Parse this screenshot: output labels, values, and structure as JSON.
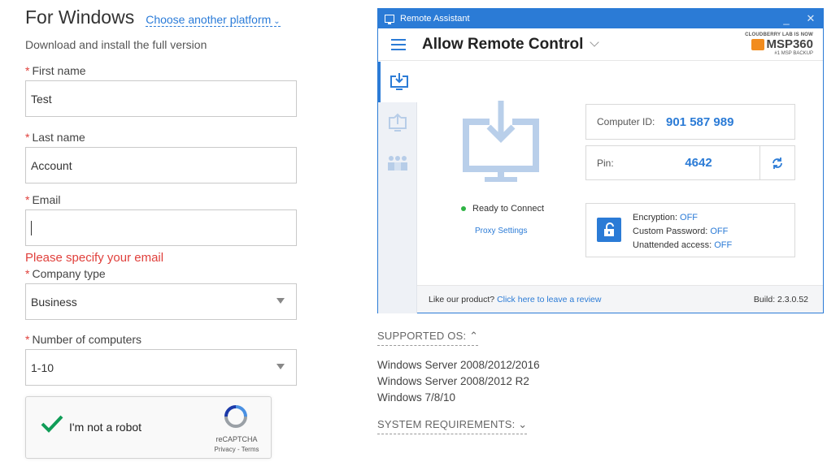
{
  "form": {
    "title": "For Windows",
    "platform_link": "Choose another platform",
    "subtitle": "Download and install the full version",
    "required_mark": "*",
    "first_name": {
      "label": "First name",
      "value": "Test"
    },
    "last_name": {
      "label": "Last name",
      "value": "Account"
    },
    "email": {
      "label": "Email",
      "value": "",
      "error": "Please specify your email"
    },
    "company_type": {
      "label": "Company type",
      "selected": "Business"
    },
    "computers": {
      "label": "Number of computers",
      "selected": "1-10"
    },
    "captcha": {
      "label": "I'm not a robot",
      "brand": "reCAPTCHA",
      "links": "Privacy - Terms"
    }
  },
  "window": {
    "title": "Remote Assistant",
    "minimize": "_",
    "close": "✕",
    "header_title": "Allow Remote Control",
    "brand": {
      "tag": "CLOUDBERRY LAB IS NOW",
      "name": "MSP360",
      "sub": "#1 MSP BACKUP",
      "color": "#f28c1e"
    },
    "status": "Ready to Connect",
    "proxy": "Proxy Settings",
    "computer_id": {
      "label": "Computer ID:",
      "value": "901 587 989"
    },
    "pin": {
      "label": "Pin:",
      "value": "4642"
    },
    "security": {
      "encryption": {
        "label": "Encryption:",
        "value": "OFF"
      },
      "custom_password": {
        "label": "Custom Password:",
        "value": "OFF"
      },
      "unattended": {
        "label": "Unattended access:",
        "value": "OFF"
      }
    },
    "footer": {
      "prompt": "Like our product?",
      "link": "Click here to leave a review",
      "build": "Build: 2.3.0.52"
    },
    "accent": "#2b7bd6"
  },
  "supported_os": {
    "label": "SUPPORTED OS:",
    "items": [
      "Windows Server 2008/2012/2016",
      "Windows Server 2008/2012 R2",
      "Windows 7/8/10"
    ]
  },
  "system_requirements": {
    "label": "SYSTEM REQUIREMENTS:"
  }
}
